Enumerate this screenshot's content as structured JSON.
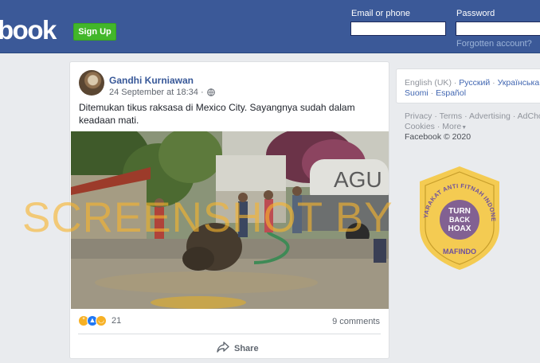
{
  "header": {
    "logo_text": "book",
    "signup_label": "Sign Up",
    "email_label": "Email or phone",
    "password_label": "Password",
    "forgot_label": "Forgotten account?",
    "bar_color": "#3b5998"
  },
  "post": {
    "author": "Gandhi Kurniawan",
    "timestamp": "24 September at 18:34 ·",
    "privacy_icon": "globe-icon",
    "text": "Ditemukan tikus raksasa di Mexico City. Sayangnya sudah dalam keadaan mati.",
    "reaction_icons": [
      "wow-icon",
      "like-icon",
      "haha-icon"
    ],
    "reaction_count": "21",
    "comments_label": "9 comments",
    "share_label": "Share"
  },
  "photo": {
    "truck_text": "AGU"
  },
  "sidebar": {
    "languages": {
      "current": "English (UK)",
      "options": [
        "Русский",
        "Українська",
        "Suomi",
        "Español"
      ]
    },
    "footer_links": [
      "Privacy",
      "Terms",
      "Advertising",
      "AdCho"
    ],
    "footer_more": [
      "Cookies",
      "More"
    ],
    "copyright": "Facebook © 2020"
  },
  "overlays": {
    "watermark_text": "SCREENSHOT BY",
    "badge_ring_text": "MASYARAKAT ANTI FITNAH INDONESIA",
    "badge_logo_line1": "TURN",
    "badge_logo_line2": "BACK",
    "badge_logo_line3": "HOAX",
    "badge_bottom_text": "MAFINDO",
    "badge_color": "#f5c840"
  }
}
